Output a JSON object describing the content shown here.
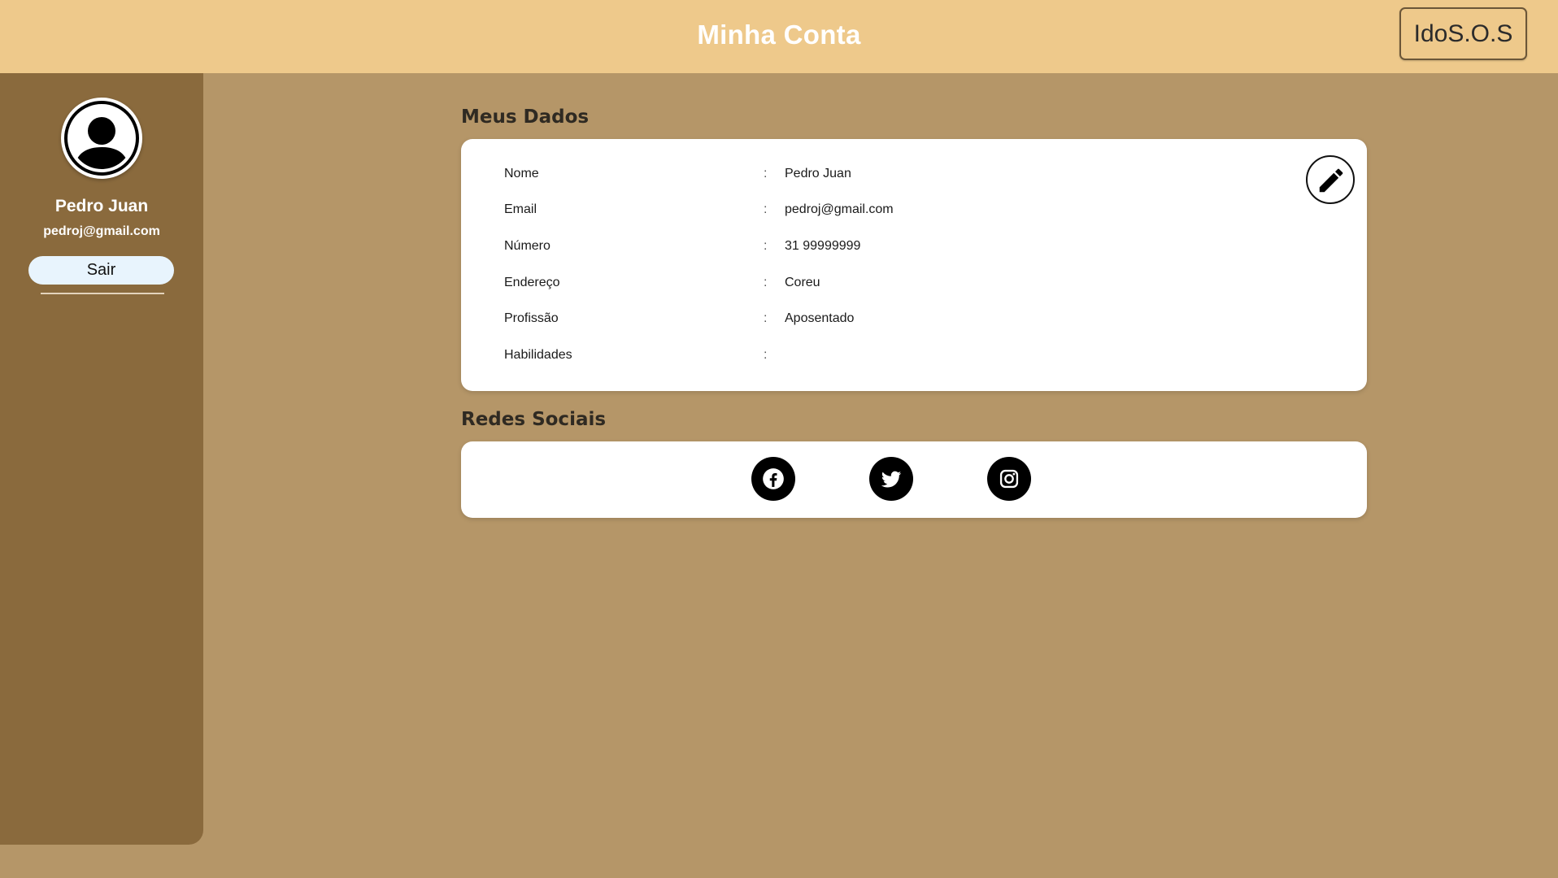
{
  "header": {
    "title": "Minha Conta",
    "brand_button": "IdoS.O.S",
    "background": "#eec98b"
  },
  "sidebar": {
    "user_name": "Pedro Juan",
    "user_email": "pedroj@gmail.com",
    "logout_label": "Sair",
    "avatar_icon": "user-avatar-icon",
    "background": "#8a6a3d"
  },
  "profile": {
    "section_title": "Meus Dados",
    "edit_icon": "pencil-icon",
    "fields": [
      {
        "label": "Nome",
        "separator": ":",
        "value": "Pedro Juan"
      },
      {
        "label": "Email",
        "separator": ":",
        "value": "pedroj@gmail.com"
      },
      {
        "label": "Número",
        "separator": ":",
        "value": "31 99999999"
      },
      {
        "label": "Endereço",
        "separator": ":",
        "value": "Coreu"
      },
      {
        "label": "Profissão",
        "separator": ":",
        "value": "Aposentado"
      },
      {
        "label": "Habilidades",
        "separator": ":",
        "value": ""
      }
    ]
  },
  "social": {
    "section_title": "Redes Sociais",
    "icons": [
      "facebook-icon",
      "twitter-icon",
      "instagram-icon"
    ]
  },
  "colors": {
    "page_background": "#b59668",
    "card_background": "#ffffff"
  }
}
